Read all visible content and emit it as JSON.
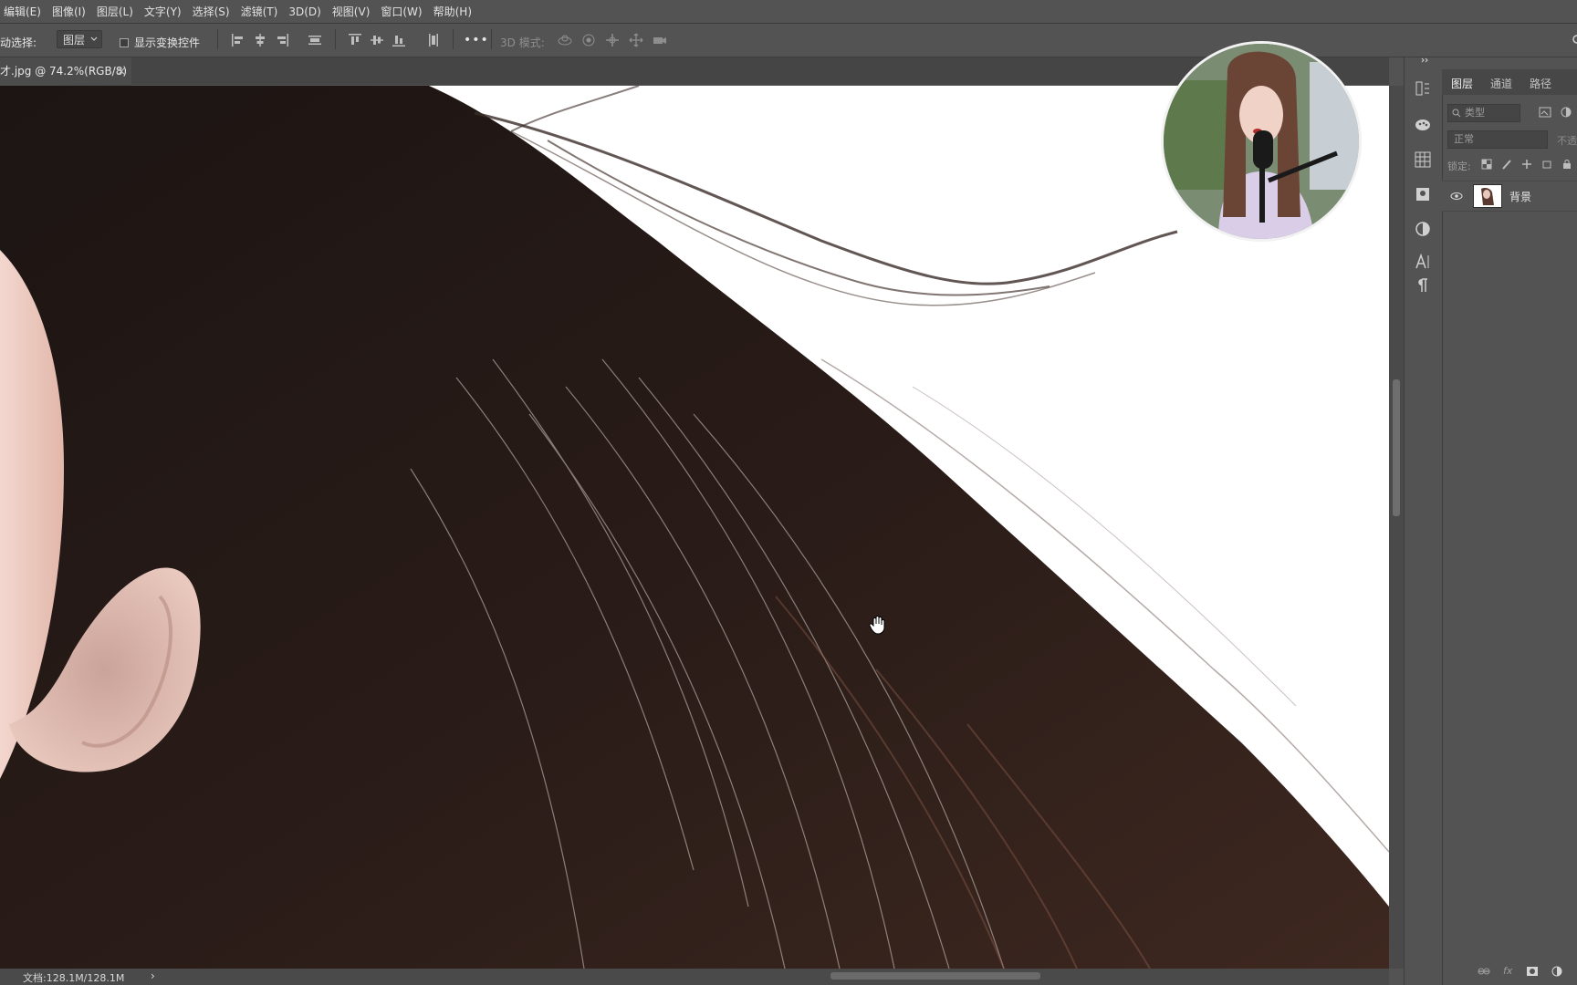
{
  "menu": [
    "编辑(E)",
    "图像(I)",
    "图层(L)",
    "文字(Y)",
    "选择(S)",
    "滤镜(T)",
    "3D(D)",
    "视图(V)",
    "窗口(W)",
    "帮助(H)"
  ],
  "options": {
    "auto_select_label": "动选择:",
    "auto_select_value": "图层",
    "show_transform_label": "显示变换控件",
    "more_label": "•••",
    "mode_3d_label": "3D 模式:"
  },
  "document": {
    "tab_title": "才.jpg @ 74.2%(RGB/8)",
    "close_glyph": "×"
  },
  "status": {
    "doc_info": "文档:128.1M/128.1M",
    "arrow": "›"
  },
  "panel": {
    "tabs": [
      "图层",
      "通道",
      "路径"
    ],
    "filter_placeholder": "类型",
    "blend_mode": "正常",
    "opacity_label": "不透",
    "lock_label": "锁定:",
    "layer_name": "背景"
  },
  "colors": {
    "ui_bg": "#535353",
    "canvas_bg": "#ffffff",
    "hair_dark": "#221a18",
    "hair_brown": "#4a2c22",
    "skin": "#e8c4b8"
  }
}
